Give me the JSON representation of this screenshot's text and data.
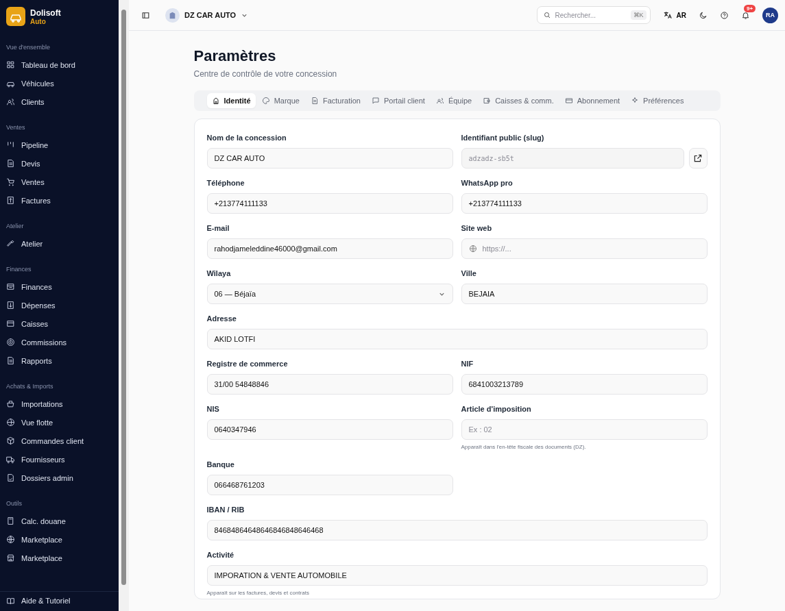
{
  "brand": {
    "name": "Dolisoft",
    "sub": "Auto"
  },
  "sidebar": {
    "sections": [
      {
        "title": "Vue d'ensemble",
        "items": [
          {
            "label": "Tableau de bord",
            "selected": false
          },
          {
            "label": "Véhicules",
            "selected": false
          },
          {
            "label": "Clients",
            "selected": false
          }
        ]
      },
      {
        "title": "Ventes",
        "items": [
          {
            "label": "Pipeline",
            "selected": false
          },
          {
            "label": "Devis",
            "selected": false
          },
          {
            "label": "Ventes",
            "selected": false
          },
          {
            "label": "Factures",
            "selected": false
          }
        ]
      },
      {
        "title": "Atelier",
        "items": [
          {
            "label": "Atelier",
            "selected": false
          }
        ]
      },
      {
        "title": "Finances",
        "items": [
          {
            "label": "Finances",
            "selected": false
          },
          {
            "label": "Dépenses",
            "selected": false
          },
          {
            "label": "Caisses",
            "selected": false
          },
          {
            "label": "Commissions",
            "selected": false
          },
          {
            "label": "Rapports",
            "selected": false
          }
        ]
      },
      {
        "title": "Achats & Imports",
        "items": [
          {
            "label": "Importations",
            "selected": false
          },
          {
            "label": "Vue flotte",
            "selected": false
          },
          {
            "label": "Commandes client",
            "selected": false
          },
          {
            "label": "Fournisseurs",
            "selected": false
          },
          {
            "label": "Dossiers admin",
            "selected": false
          }
        ]
      },
      {
        "title": "Outils",
        "items": [
          {
            "label": "Calc. douane",
            "selected": false
          },
          {
            "label": "Marketplace",
            "selected": false
          },
          {
            "label": "Marketplace",
            "selected": false
          }
        ]
      }
    ],
    "footer": {
      "label": "Aide & Tutoriel"
    }
  },
  "topbar": {
    "company": "DZ CAR AUTO",
    "search": {
      "placeholder": "Rechercher...",
      "shortcut": "⌘K"
    },
    "language": "AR",
    "notifications": "9+",
    "avatar": "RA"
  },
  "page": {
    "title": "Paramètres",
    "subtitle": "Centre de contrôle de votre concession"
  },
  "tabs": [
    {
      "label": "Identité",
      "selected": true
    },
    {
      "label": "Marque",
      "selected": false
    },
    {
      "label": "Facturation",
      "selected": false
    },
    {
      "label": "Portail client",
      "selected": false
    },
    {
      "label": "Équipe",
      "selected": false
    },
    {
      "label": "Caisses & comm.",
      "selected": false
    },
    {
      "label": "Abonnement",
      "selected": false
    },
    {
      "label": "Préférences",
      "selected": false
    }
  ],
  "fields": [
    {
      "kind": "text",
      "label": "Nom de la concession",
      "value": "DZ CAR AUTO"
    },
    {
      "kind": "slug",
      "label": "Identifiant public (slug)",
      "value": "adzadz-sb5t",
      "disabled": true
    },
    {
      "kind": "text",
      "label": "Téléphone",
      "value": "+213774111133"
    },
    {
      "kind": "text",
      "label": "WhatsApp pro",
      "value": "+213774111133"
    },
    {
      "kind": "text",
      "label": "E-mail",
      "value": "rahodjameleddine46000@gmail.com"
    },
    {
      "kind": "url",
      "label": "Site web",
      "placeholder": "https://..."
    },
    {
      "kind": "select",
      "label": "Wilaya",
      "value": "06 — Béjaïa"
    },
    {
      "kind": "text",
      "label": "Ville",
      "value": "BEJAIA"
    },
    {
      "kind": "text",
      "label": "Adresse",
      "value": "AKID LOTFI",
      "full": true
    },
    {
      "kind": "text",
      "label": "Registre de commerce",
      "value": "31/00 54848846"
    },
    {
      "kind": "text",
      "label": "NIF",
      "value": "6841003213789"
    },
    {
      "kind": "text",
      "label": "NIS",
      "value": "0640347946"
    },
    {
      "kind": "text",
      "label": "Article d'imposition",
      "placeholder": "Ex : 02",
      "hint": "Apparaît dans l'en-tête fiscale des documents (DZ)."
    },
    {
      "kind": "text",
      "label": "Banque",
      "value": "066468761203"
    },
    {
      "kind": "text",
      "label": "IBAN / RIB",
      "value": "84684864648646846848646468",
      "full": true
    },
    {
      "kind": "text",
      "label": "Activité",
      "value": "IMPORATION & VENTE AUTOMOBILE",
      "full": true,
      "hint": "Apparaît sur les factures, devis et contrats"
    }
  ]
}
